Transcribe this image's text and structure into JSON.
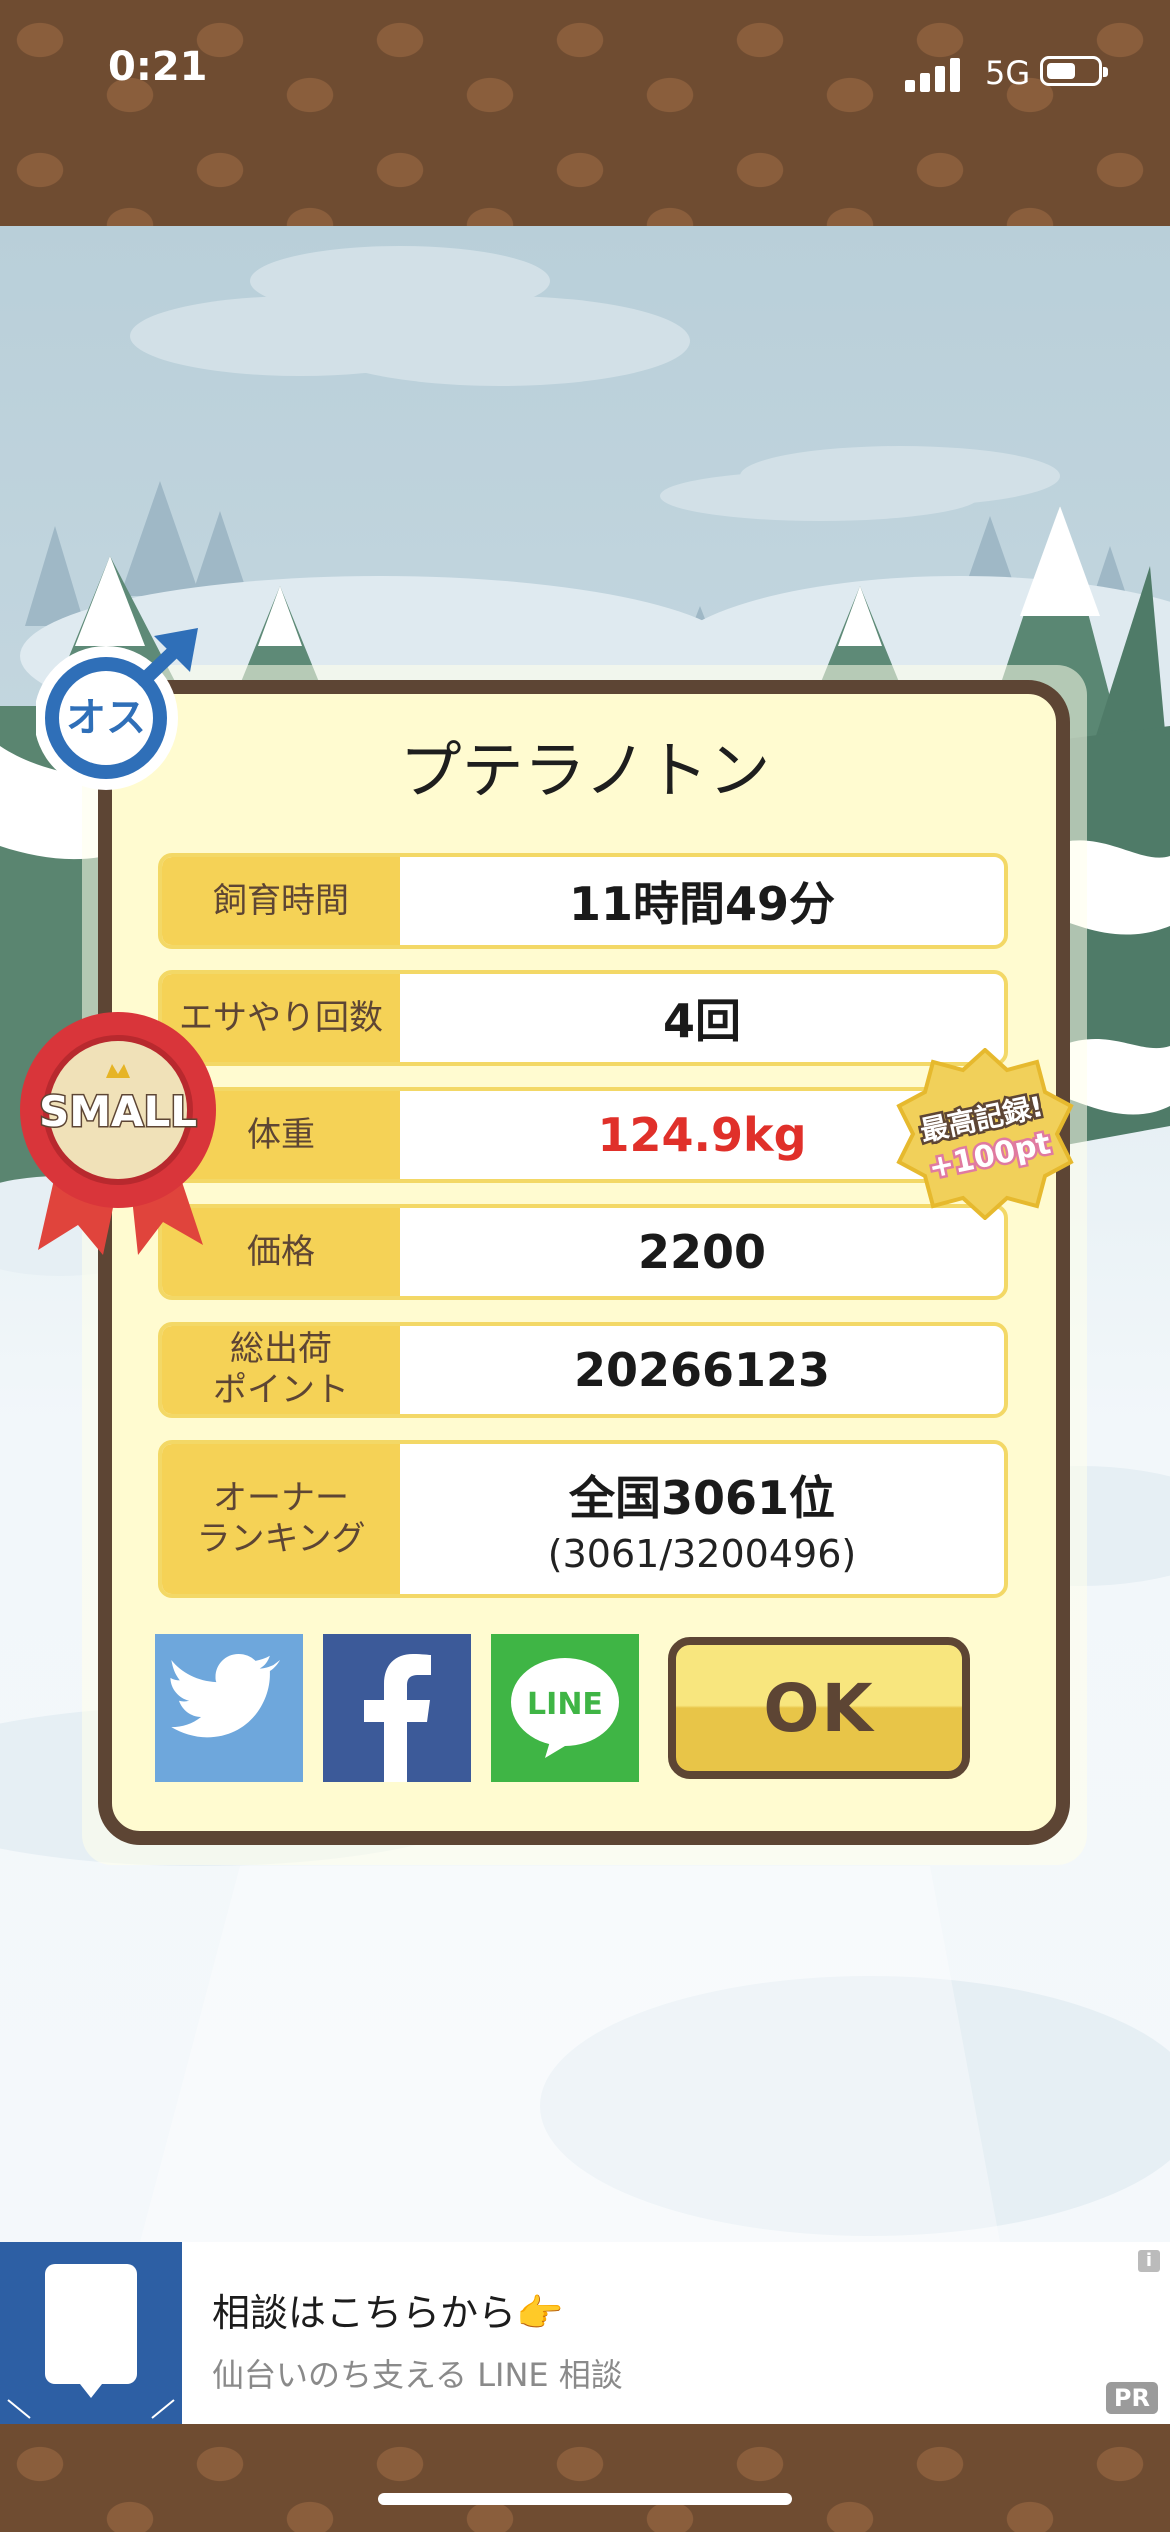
{
  "status_bar": {
    "time": "0:21",
    "network": "5G"
  },
  "card": {
    "title": "プテラノトン",
    "gender_badge": "オス",
    "size_badge": "SMALL",
    "record_badge": {
      "line1": "最高記録!",
      "line2": "+100pt"
    },
    "rows": [
      {
        "label": "飼育時間",
        "value": "11時間49分"
      },
      {
        "label": "エサやり回数",
        "value": "4回"
      },
      {
        "label": "体重",
        "value": "124.9kg"
      },
      {
        "label": "価格",
        "value": "2200"
      },
      {
        "label": "総出荷\nポイント",
        "value": "20266123"
      },
      {
        "label": "オーナー\nランキング",
        "value": "全国3061位",
        "sub": "(3061/3200496)"
      }
    ],
    "share": {
      "line_label": "LINE"
    },
    "ok_label": "OK"
  },
  "ad": {
    "title": "相談はこちらから👉",
    "subtitle": "仙台いのち支える LINE 相談",
    "pr": "PR",
    "info": "i"
  },
  "colors": {
    "brown": "#5d4534",
    "card_bg": "#fffbd0",
    "label_bg": "#f5d256",
    "weight_red": "#e0302a",
    "twitter": "#6ea7dc",
    "facebook": "#3c5a99",
    "line": "#3fb545"
  }
}
